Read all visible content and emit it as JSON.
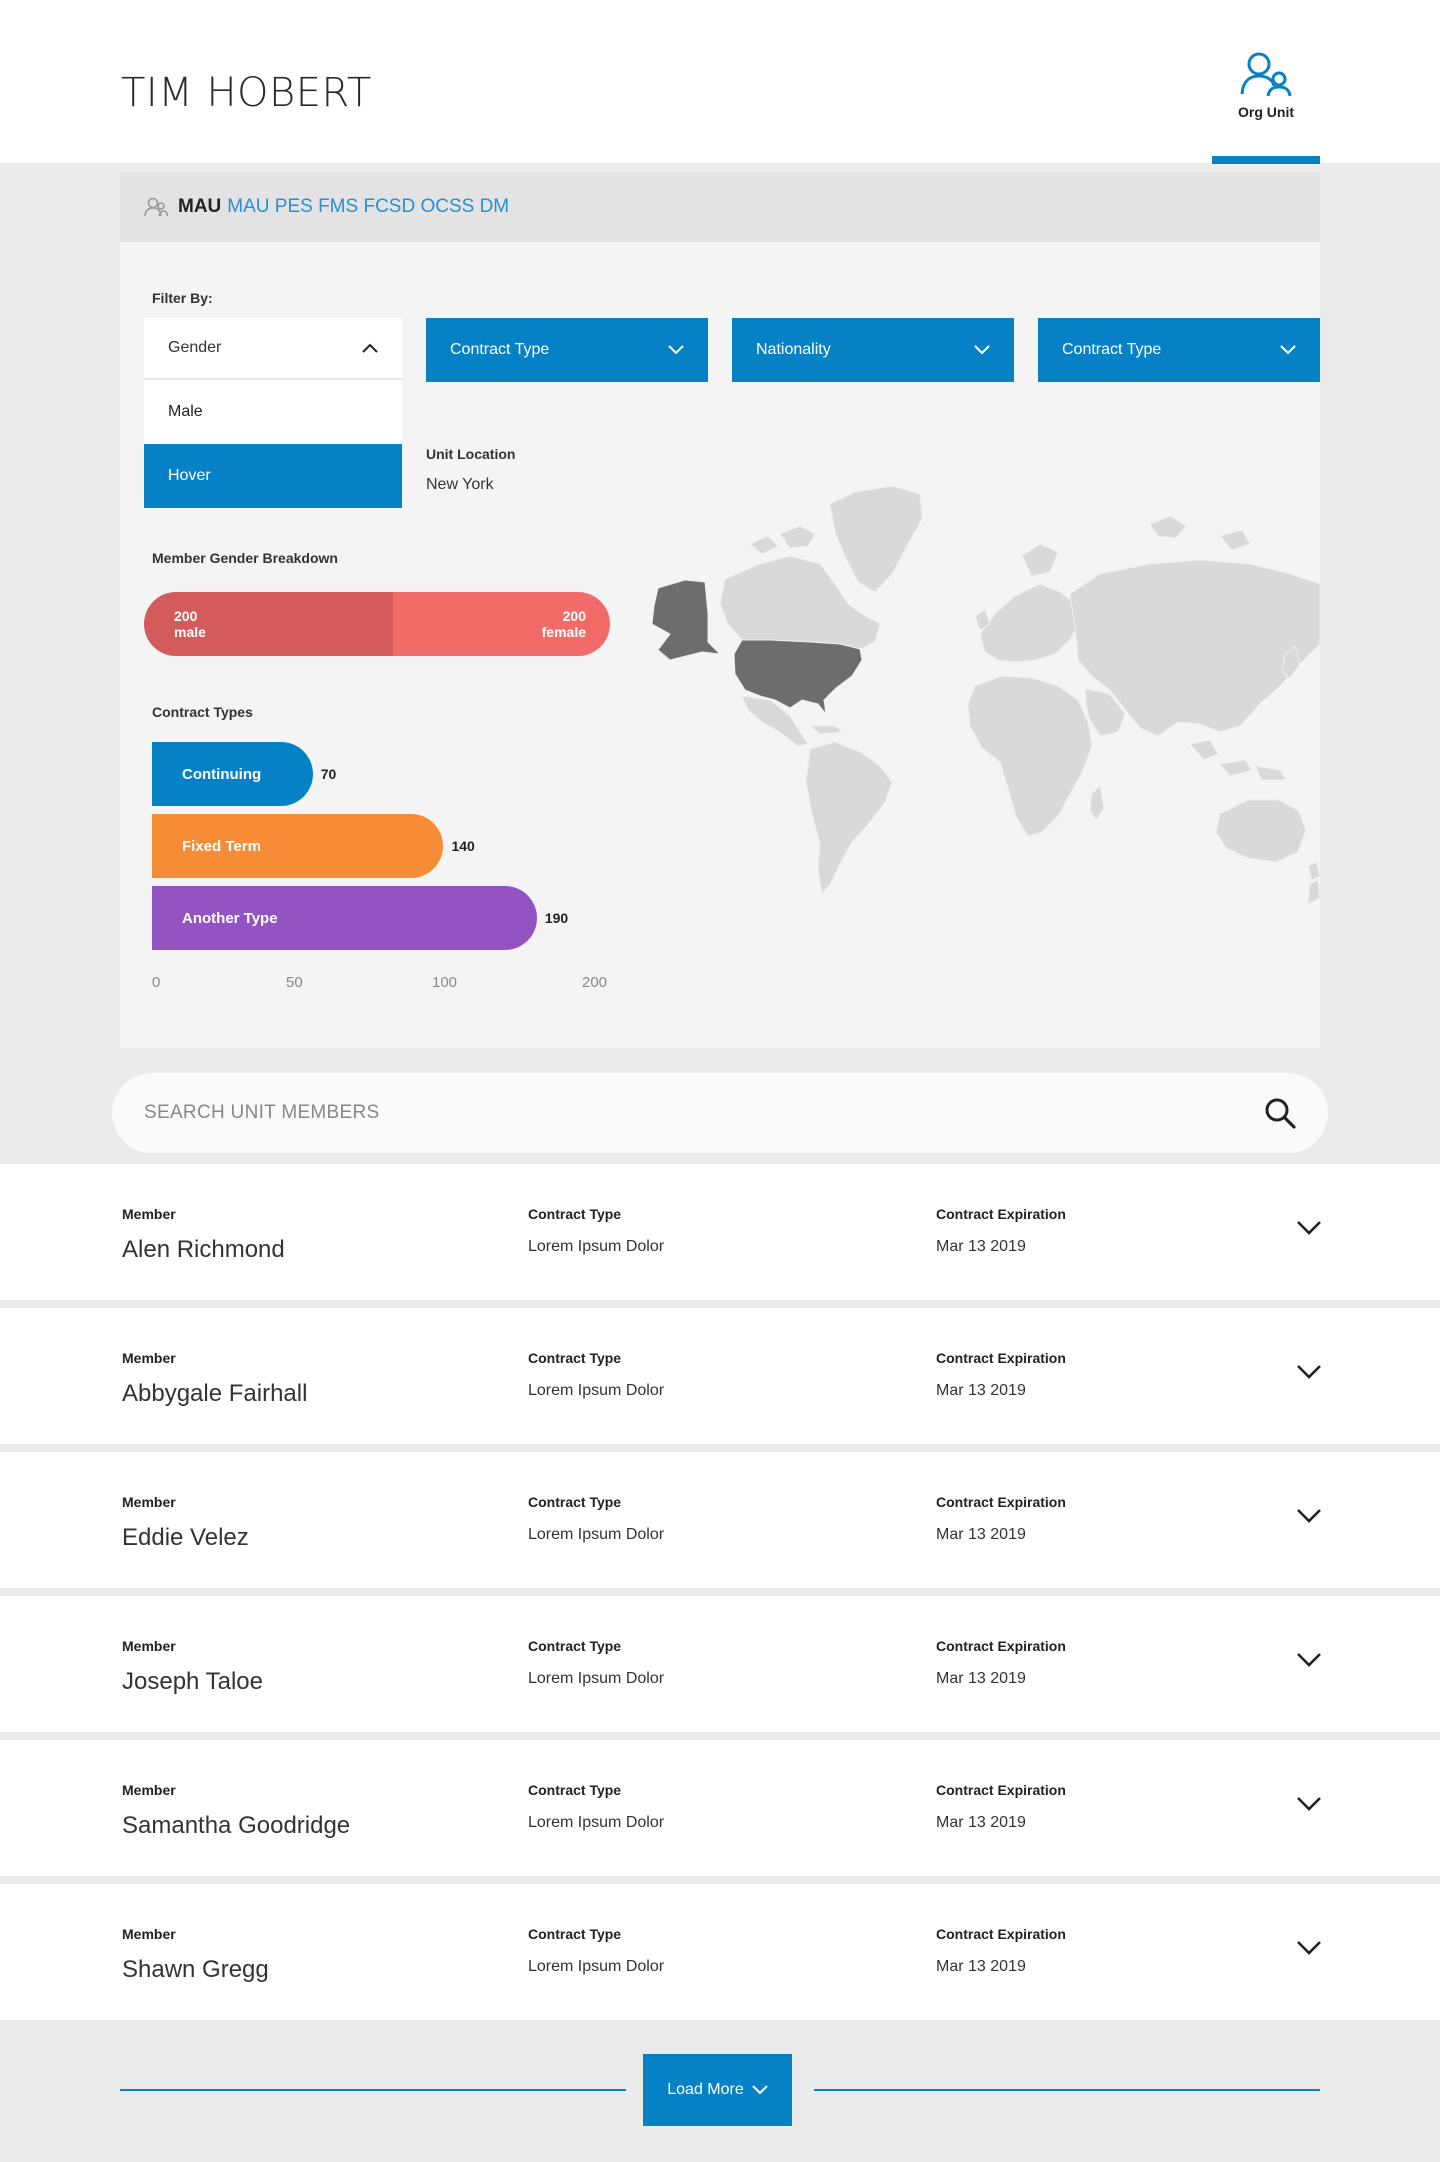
{
  "header": {
    "title": "TIM HOBERT",
    "org_unit_label": "Org Unit"
  },
  "breadcrumb": {
    "current": "MAU",
    "links": "MAU PES FMS FCSD OCSS DM"
  },
  "filters": {
    "label": "Filter By:",
    "gender": {
      "label": "Gender",
      "options": [
        "Male",
        "Hover"
      ]
    },
    "dropdowns": [
      "Contract Type",
      "Nationality",
      "Contract Type"
    ]
  },
  "unit_location": {
    "label": "Unit Location",
    "value": "New York"
  },
  "gender_breakdown": {
    "label": "Member Gender Breakdown",
    "male": {
      "count": "200",
      "label": "male",
      "value": 200,
      "color": "#d45b5b"
    },
    "female": {
      "count": "200",
      "label": "female",
      "value": 200,
      "color": "#f36b69"
    }
  },
  "chart_data": {
    "type": "bar",
    "title": "Contract Types",
    "orientation": "horizontal",
    "categories": [
      "Continuing",
      "Fixed Term",
      "Another Type"
    ],
    "values": [
      70,
      140,
      190
    ],
    "colors": [
      "#0781c5",
      "#f68c35",
      "#9353c0"
    ],
    "xlim": [
      0,
      200
    ],
    "ticks": [
      "0",
      "50",
      "100",
      "200"
    ]
  },
  "search": {
    "placeholder": "SEARCH UNIT MEMBERS"
  },
  "members_columns": {
    "member": "Member",
    "contract_type": "Contract Type",
    "expiration": "Contract Expiration"
  },
  "members": [
    {
      "name": "Alen Richmond",
      "contract_type": "Lorem Ipsum Dolor",
      "expiration": "Mar 13 2019"
    },
    {
      "name": "Abbygale Fairhall",
      "contract_type": "Lorem Ipsum Dolor",
      "expiration": "Mar 13 2019"
    },
    {
      "name": "Eddie Velez",
      "contract_type": "Lorem Ipsum Dolor",
      "expiration": "Mar 13 2019"
    },
    {
      "name": "Joseph Taloe",
      "contract_type": "Lorem Ipsum Dolor",
      "expiration": "Mar 13 2019"
    },
    {
      "name": "Samantha Goodridge",
      "contract_type": "Lorem Ipsum Dolor",
      "expiration": "Mar 13 2019"
    },
    {
      "name": "Shawn Gregg",
      "contract_type": "Lorem Ipsum Dolor",
      "expiration": "Mar 13 2019"
    }
  ],
  "load_more": {
    "label": "Load More"
  },
  "colors": {
    "accent": "#0781c5",
    "map_highlight": "#6d6d6d",
    "map_land": "#d9d9d9"
  },
  "icons": {
    "org_unit": "org-unit-icon",
    "users": "users-icon",
    "search": "search-icon",
    "chevron": "chevron-down-icon"
  }
}
